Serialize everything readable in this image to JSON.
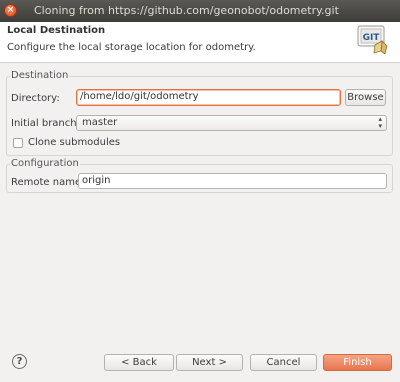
{
  "window": {
    "title": "Cloning from https://github.com/geonobot/odometry.git",
    "close_icon": "×"
  },
  "header": {
    "title": "Local Destination",
    "description": "Configure the local storage location for odometry.",
    "logo_text": "GIT"
  },
  "destination": {
    "group_label": "Destination",
    "directory_label": "Directory:",
    "directory_value": "/home/ldo/git/odometry",
    "browse_label": "Browse",
    "branch_label": "Initial branch:",
    "branch_value": "master",
    "clone_submodules_label": "Clone submodules",
    "clone_submodules_checked": false
  },
  "configuration": {
    "group_label": "Configuration",
    "remote_name_label": "Remote name:",
    "remote_name_value": "origin"
  },
  "footer": {
    "help_icon": "?",
    "back_label": "< Back",
    "next_label": "Next >",
    "cancel_label": "Cancel",
    "finish_label": "Finish"
  },
  "colors": {
    "accent": "#e8774d",
    "titlebar": "#4a4945",
    "background": "#f2f1f0"
  }
}
